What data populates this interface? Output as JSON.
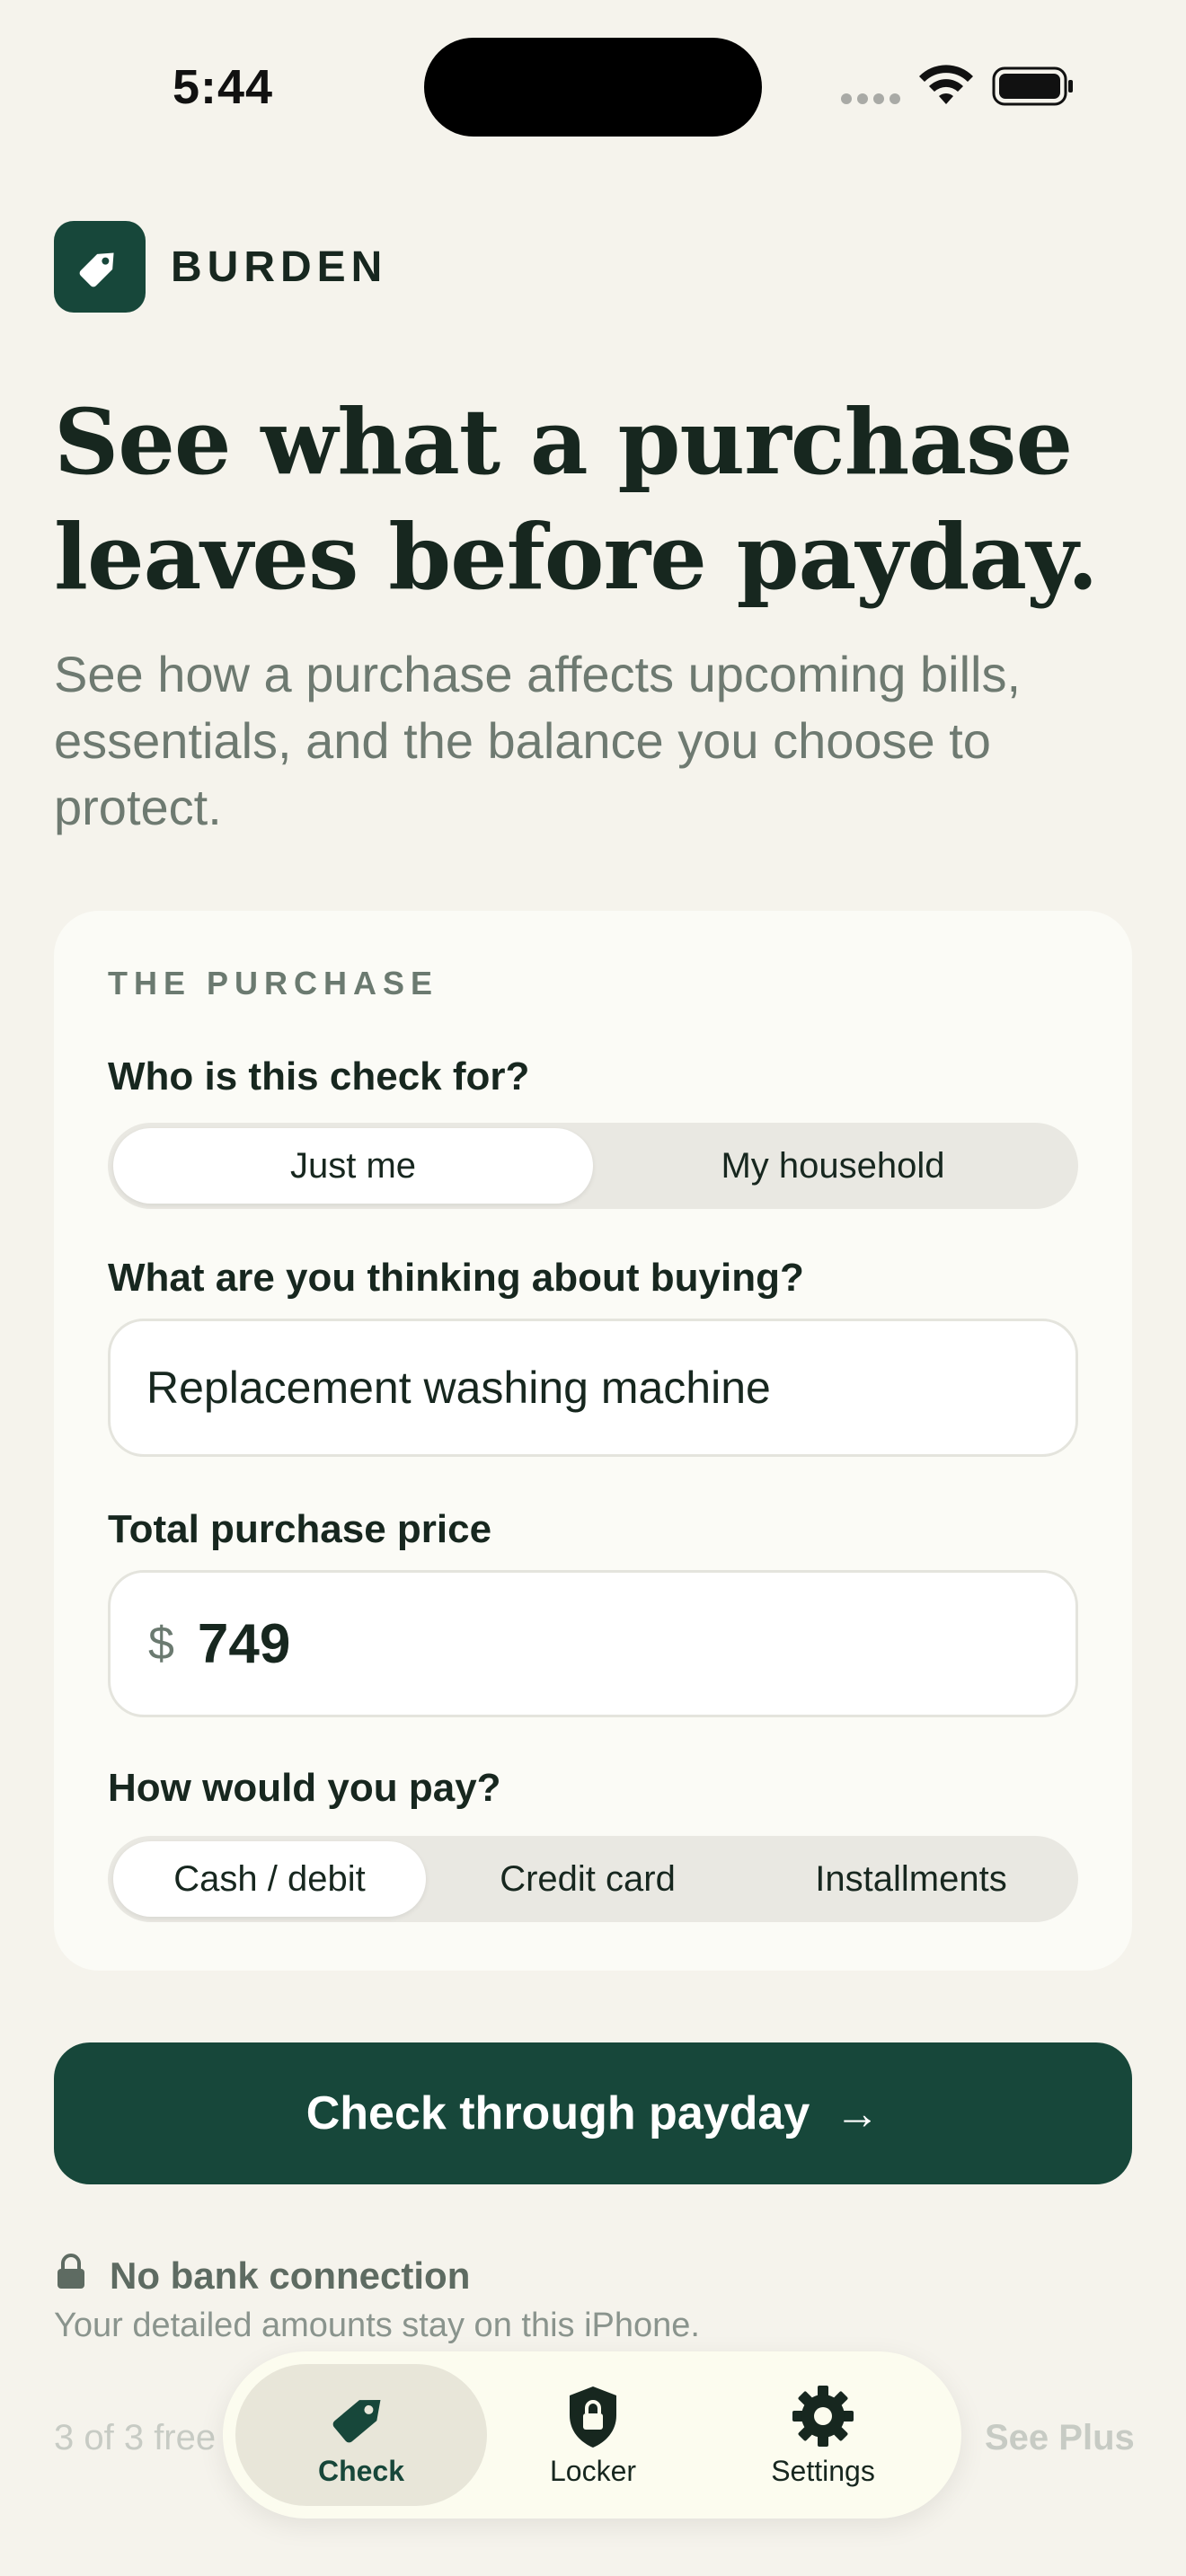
{
  "status_bar": {
    "time": "5:44"
  },
  "brand": {
    "name": "BURDEN",
    "logo_icon": "price-tag-icon",
    "color": "#17473a"
  },
  "hero": {
    "headline_line1": "See what a purchase",
    "headline_line2": "leaves before payday.",
    "subhead": "See how a purchase affects upcoming bills, essentials, and the balance you choose to protect."
  },
  "purchase_card": {
    "section_label": "THE PURCHASE",
    "who_label": "Who is this check for?",
    "who_options": [
      "Just me",
      "My household"
    ],
    "who_selected": "Just me",
    "item_label": "What are you thinking about buying?",
    "item_value": "Replacement washing machine",
    "price_label": "Total purchase price",
    "currency_symbol": "$",
    "price_value": "749",
    "pay_label": "How would you pay?",
    "pay_options": [
      "Cash / debit",
      "Credit card",
      "Installments"
    ],
    "pay_selected": "Cash / debit"
  },
  "cta": {
    "label": "Check through payday",
    "arrow": "→"
  },
  "privacy": {
    "title": "No bank connection",
    "detail": "Your detailed amounts stay on this iPhone."
  },
  "footer": {
    "free_checks": "3 of 3 free",
    "see_plus": "See Plus"
  },
  "tabs": [
    {
      "label": "Check",
      "icon": "tag-icon",
      "active": true
    },
    {
      "label": "Locker",
      "icon": "lock-shield-icon",
      "active": false
    },
    {
      "label": "Settings",
      "icon": "gear-icon",
      "active": false
    }
  ]
}
